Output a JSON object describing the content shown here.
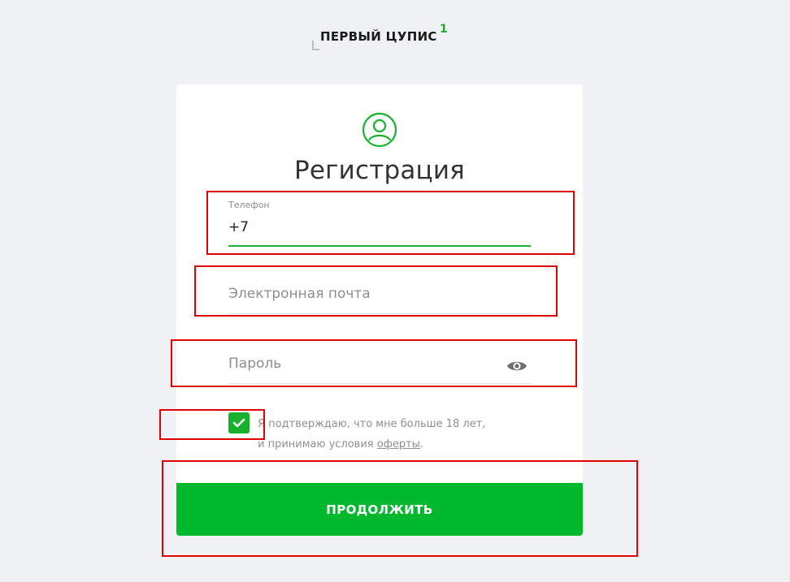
{
  "logo": {
    "text": "ПЕРВЫЙ ЦУПИС",
    "superscript": "1"
  },
  "form": {
    "title": "Регистрация",
    "phone": {
      "label": "Телефон",
      "value": "+7"
    },
    "email": {
      "placeholder": "Электронная почта",
      "value": ""
    },
    "password": {
      "placeholder": "Пароль",
      "value": ""
    },
    "consent": {
      "checked": true,
      "line1": "Я подтверждаю, что мне больше 18 лет,",
      "line2_prefix": "и принимаю условия ",
      "link": "оферты",
      "line2_suffix": "."
    },
    "submit_label": "ПРОДОЛЖИТЬ"
  },
  "icons": {
    "user": "user-circle-icon",
    "eye": "eye-icon",
    "check": "check-icon"
  },
  "colors": {
    "accent": "#00b82e",
    "background": "#f0f1f5",
    "annotation": "#e00000"
  }
}
